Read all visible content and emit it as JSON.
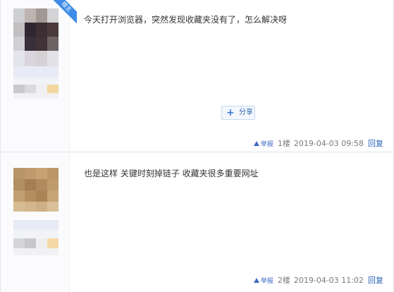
{
  "posts": [
    {
      "badge": "楼主",
      "content": "今天打开浏览器，突然发现收藏夹没有了，怎么解决呀",
      "share_label": "分享",
      "report_label": "举报",
      "floor": "1楼",
      "date": "2019-04-03 09:58",
      "reply_label": "回复"
    },
    {
      "content": "也是这样 关键时刻掉链子 收藏夹很多重要网址",
      "report_label": "举报",
      "floor": "2楼",
      "date": "2019-04-03 11:02",
      "reply_label": "回复"
    }
  ],
  "icons": {
    "report": "warning-icon",
    "share": "plus-icon"
  },
  "colors": {
    "link": "#2d64b3",
    "badge": "#3f8ce7",
    "border": "#e1e4e6"
  }
}
